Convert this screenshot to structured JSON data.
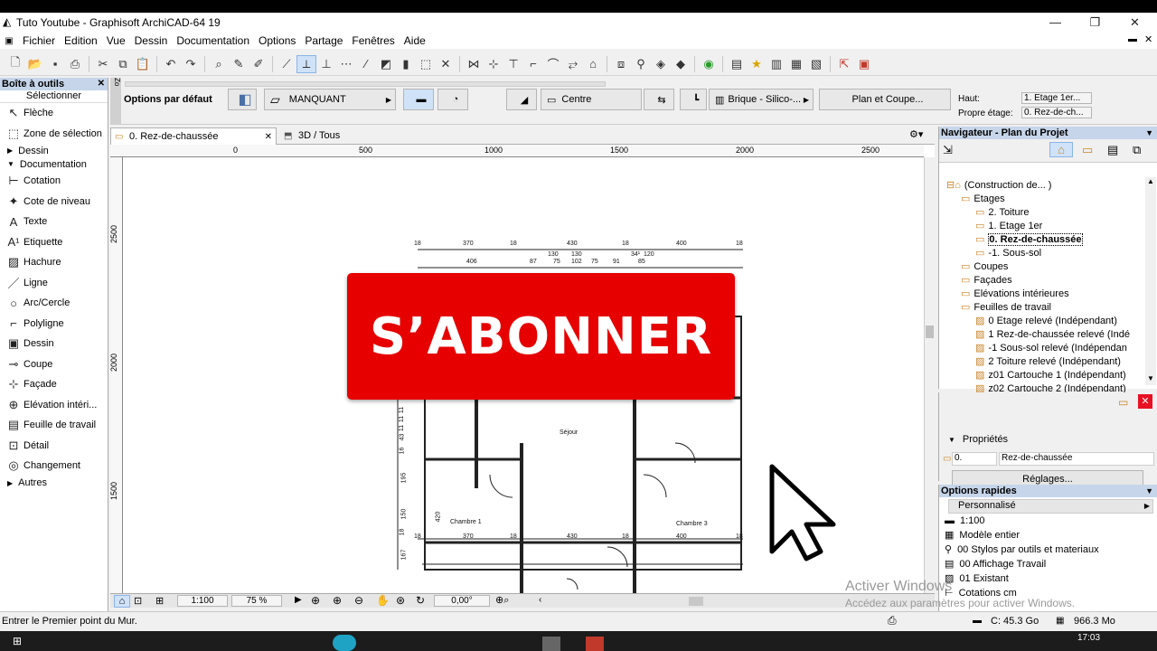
{
  "window": {
    "title": "Tuto Youtube - Graphisoft ArchiCAD-64 19",
    "minimize": "—",
    "restore": "❐",
    "close": "✕"
  },
  "menu": [
    "Fichier",
    "Edition",
    "Vue",
    "Dessin",
    "Documentation",
    "Options",
    "Partage",
    "Fenêtres",
    "Aide"
  ],
  "toolbox": {
    "title": "Boîte à outils",
    "select_label": "Sélectionner",
    "tools_top": [
      {
        "label": "Flèche",
        "icon": "arrow-icon"
      },
      {
        "label": "Zone de sélection",
        "icon": "marquee-icon"
      }
    ],
    "group_dessin": "Dessin",
    "group_documentation": "Documentation",
    "tools_doc": [
      {
        "label": "Cotation",
        "icon": "dimension-icon"
      },
      {
        "label": "Cote de niveau",
        "icon": "level-dimension-icon"
      },
      {
        "label": "Texte",
        "icon": "text-icon"
      },
      {
        "label": "Etiquette",
        "icon": "label-icon"
      },
      {
        "label": "Hachure",
        "icon": "fill-icon"
      },
      {
        "label": "Ligne",
        "icon": "line-icon"
      },
      {
        "label": "Arc/Cercle",
        "icon": "circle-icon"
      },
      {
        "label": "Polyligne",
        "icon": "polyline-icon"
      },
      {
        "label": "Dessin",
        "icon": "drawing-icon"
      },
      {
        "label": "Coupe",
        "icon": "section-icon"
      },
      {
        "label": "Façade",
        "icon": "elevation-icon"
      },
      {
        "label": "Elévation intéri...",
        "icon": "interior-elevation-icon"
      },
      {
        "label": "Feuille de travail",
        "icon": "worksheet-icon"
      },
      {
        "label": "Détail",
        "icon": "detail-icon"
      },
      {
        "label": "Changement",
        "icon": "change-icon"
      }
    ],
    "group_autres": "Autres"
  },
  "infobox": {
    "default_options": "Options par défaut",
    "missing": "MANQUANT",
    "center": "Centre",
    "material": "Brique - Silico-...",
    "plan_section": "Plan et Coupe...",
    "top_label": "Haut:",
    "top_value": "1. Etage 1er...",
    "home_label": "Propre étage:",
    "home_value": "0. Rez-de-ch..."
  },
  "tabs": [
    {
      "label": "0. Rez-de-chaussée",
      "close": "✕"
    },
    {
      "label": "3D / Tous"
    }
  ],
  "ruler": {
    "top_ticks": [
      "0",
      "500",
      "1000",
      "1500",
      "2000",
      "2500"
    ],
    "left_ticks": [
      "2500",
      "2000",
      "1500"
    ]
  },
  "plan": {
    "dims_top": [
      "18",
      "370",
      "18",
      "430",
      "18",
      "400",
      "18"
    ],
    "dims_second": [
      "406",
      "87",
      "75",
      "102",
      "75",
      "91",
      "85"
    ],
    "dims_small": [
      "34¹",
      "130",
      "130",
      "120"
    ],
    "dims_bottom": [
      "18",
      "370",
      "18",
      "430",
      "18",
      "400",
      "18"
    ],
    "dims_left": [
      "11",
      "11",
      "11",
      "43",
      "16",
      "195",
      "150",
      "18",
      "167"
    ],
    "room_sejour": "Séjour",
    "room_chambre1": "Chambre 1",
    "room_chambre3": "Chambre 3",
    "dim_420": "420",
    "stair_number": "8"
  },
  "overlay": {
    "subscribe": "S’ABONNER"
  },
  "bottombar": {
    "scale": "1:100",
    "zoom": "75 %",
    "angle": "0,00°"
  },
  "navigator": {
    "title": "Navigateur - Plan du Projet",
    "items": [
      {
        "label": "(Construction de... )",
        "indent": 0
      },
      {
        "label": "Etages",
        "indent": 1
      },
      {
        "label": "2. Toiture",
        "indent": 2
      },
      {
        "label": "1. Etage 1er",
        "indent": 2
      },
      {
        "label": "0. Rez-de-chaussée",
        "indent": 2,
        "selected": true
      },
      {
        "label": "-1. Sous-sol",
        "indent": 2
      },
      {
        "label": "Coupes",
        "indent": 1
      },
      {
        "label": "Façades",
        "indent": 1
      },
      {
        "label": "Elévations intérieures",
        "indent": 1
      },
      {
        "label": "Feuilles de travail",
        "indent": 1
      },
      {
        "label": "0 Etage relevé (Indépendant)",
        "indent": 2
      },
      {
        "label": "1 Rez-de-chaussée relevé (Indé",
        "indent": 2
      },
      {
        "label": "-1 Sous-sol relevé (Indépendan",
        "indent": 2
      },
      {
        "label": "2 Toiture relevé (Indépendant)",
        "indent": 2
      },
      {
        "label": "z01 Cartouche 1 (Indépendant)",
        "indent": 2
      },
      {
        "label": "z02 Cartouche 2 (Indépendant)",
        "indent": 2
      }
    ]
  },
  "properties": {
    "title": "Propriétés",
    "id": "0.",
    "name": "Rez-de-chaussée",
    "settings": "Réglages..."
  },
  "quick_options": {
    "title": "Options rapides",
    "preset": "Personnalisé",
    "items": [
      "1:100",
      "Modèle entier",
      "00 Stylos par outils et materiaux",
      "00 Affichage Travail",
      "01 Existant",
      "Cotations cm"
    ]
  },
  "status": {
    "message": "Entrer le Premier point du Mur.",
    "disk": "C: 45.3 Go",
    "memory": "966.3 Mo"
  },
  "watermark": {
    "line1": "Activer Windows",
    "line2": "Accédez aux paramètres pour activer Windows."
  },
  "taskbar": {
    "time": "17:03"
  },
  "colors": {
    "subscribe_bg": "#e60000",
    "panel_header": "#c6d5e9",
    "selection": "#cfe2f7"
  }
}
